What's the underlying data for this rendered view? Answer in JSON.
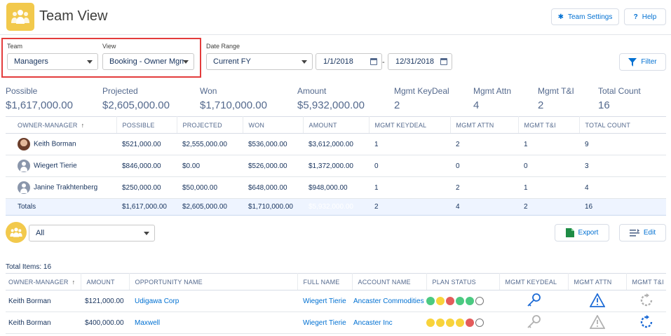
{
  "header": {
    "title": "Team View",
    "team_settings_label": "Team Settings",
    "help_label": "Help"
  },
  "controls": {
    "team_label": "Team",
    "team_value": "Managers",
    "view_label": "View",
    "view_value": "Booking - Owner Mgmt",
    "date_range_label": "Date Range",
    "date_range_value": "Current FY",
    "start_date": "1/1/2018",
    "separator": "-",
    "end_date": "12/31/2018",
    "filter_label": "Filter"
  },
  "summary": [
    {
      "label": "Possible",
      "value": "$1,617,000.00"
    },
    {
      "label": "Projected",
      "value": "$2,605,000.00"
    },
    {
      "label": "Won",
      "value": "$1,710,000.00"
    },
    {
      "label": "Amount",
      "value": "$5,932,000.00"
    },
    {
      "label": "Mgmt KeyDeal",
      "value": "2"
    },
    {
      "label": "Mgmt Attn",
      "value": "4"
    },
    {
      "label": "Mgmt T&I",
      "value": "2"
    },
    {
      "label": "Total Count",
      "value": "16"
    }
  ],
  "summary_table": {
    "headers": [
      "OWNER-MANAGER",
      "POSSIBLE",
      "PROJECTED",
      "WON",
      "AMOUNT",
      "MGMT KEYDEAL",
      "MGMT ATTN",
      "MGMT T&I",
      "TOTAL COUNT"
    ],
    "sort_icon": "↑",
    "rows": [
      {
        "name": "Keith Borman",
        "possible": "$521,000.00",
        "projected": "$2,555,000.00",
        "won": "$536,000.00",
        "amount": "$3,612,000.00",
        "keydeal": "1",
        "attn": "2",
        "ti": "1",
        "count": "9"
      },
      {
        "name": "Wiegert Tierie",
        "possible": "$846,000.00",
        "projected": "$0.00",
        "won": "$526,000.00",
        "amount": "$1,372,000.00",
        "keydeal": "0",
        "attn": "0",
        "ti": "0",
        "count": "3"
      },
      {
        "name": "Janine Trakhtenberg",
        "possible": "$250,000.00",
        "projected": "$50,000.00",
        "won": "$648,000.00",
        "amount": "$948,000.00",
        "keydeal": "1",
        "attn": "2",
        "ti": "1",
        "count": "4"
      }
    ],
    "totals": {
      "label": "Totals",
      "possible": "$1,617,000.00",
      "projected": "$2,605,000.00",
      "won": "$1,710,000.00",
      "amount": "$5,932,000.00",
      "keydeal": "2",
      "attn": "4",
      "ti": "2",
      "count": "16"
    }
  },
  "list_filter": {
    "value": "All",
    "export_label": "Export",
    "edit_label": "Edit"
  },
  "items": {
    "total_label": "Total Items: 16",
    "headers": [
      "OWNER-MANAGER",
      "AMOUNT",
      "OPPORTUNITY NAME",
      "FULL NAME",
      "ACCOUNT NAME",
      "PLAN STATUS",
      "MGMT KEYDEAL",
      "MGMT ATTN",
      "MGMT T&I"
    ],
    "rows": [
      {
        "owner": "Keith Borman",
        "amount": "$121,000.00",
        "opportunity": "Udigawa Corp",
        "full_name": "Wiegert Tierie",
        "account": "Ancaster Commodities",
        "plan": [
          "green",
          "yellow",
          "red",
          "green",
          "green",
          "empty"
        ]
      },
      {
        "owner": "Keith Borman",
        "amount": "$400,000.00",
        "opportunity": "Maxwell",
        "full_name": "Wiegert Tierie",
        "account": "Ancaster Inc",
        "plan": [
          "yellow",
          "yellow",
          "yellow",
          "yellow",
          "red",
          "empty"
        ]
      }
    ]
  },
  "colors": {
    "accent": "#0070d2",
    "app_icon": "#f2c94c",
    "highlight_border": "#e33c3c",
    "amount_highlight": "#1b6ad5"
  }
}
